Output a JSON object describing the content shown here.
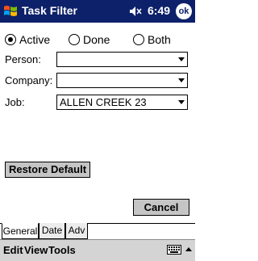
{
  "titlebar": {
    "title": "Task Filter",
    "time": "6:49",
    "ok_label": "ok"
  },
  "status_filter": {
    "options": [
      {
        "label": "Active",
        "checked": true
      },
      {
        "label": "Done",
        "checked": false
      },
      {
        "label": "Both",
        "checked": false
      }
    ]
  },
  "fields": {
    "person": {
      "label": "Person:",
      "value": ""
    },
    "company": {
      "label": "Company:",
      "value": ""
    },
    "job": {
      "label": "Job:",
      "value": "ALLEN CREEK 23"
    }
  },
  "buttons": {
    "restore_default": "Restore Default",
    "cancel": "Cancel"
  },
  "tabs": [
    {
      "label": "General",
      "active": true
    },
    {
      "label": "Date",
      "active": false
    },
    {
      "label": "Adv",
      "active": false
    }
  ],
  "menubar": {
    "items": [
      "Edit",
      "View",
      "Tools"
    ]
  }
}
